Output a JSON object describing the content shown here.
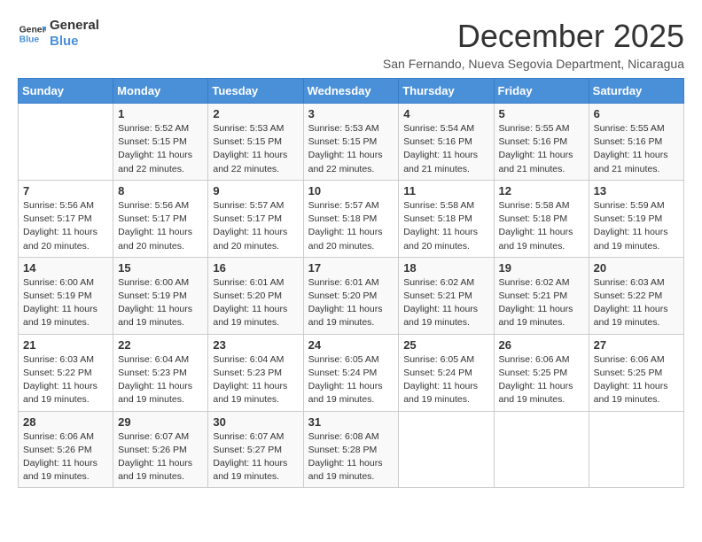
{
  "header": {
    "logo_line1": "General",
    "logo_line2": "Blue",
    "month_year": "December 2025",
    "subtitle": "San Fernando, Nueva Segovia Department, Nicaragua"
  },
  "days_of_week": [
    "Sunday",
    "Monday",
    "Tuesday",
    "Wednesday",
    "Thursday",
    "Friday",
    "Saturday"
  ],
  "weeks": [
    [
      {
        "day": "",
        "info": ""
      },
      {
        "day": "1",
        "info": "Sunrise: 5:52 AM\nSunset: 5:15 PM\nDaylight: 11 hours\nand 22 minutes."
      },
      {
        "day": "2",
        "info": "Sunrise: 5:53 AM\nSunset: 5:15 PM\nDaylight: 11 hours\nand 22 minutes."
      },
      {
        "day": "3",
        "info": "Sunrise: 5:53 AM\nSunset: 5:15 PM\nDaylight: 11 hours\nand 22 minutes."
      },
      {
        "day": "4",
        "info": "Sunrise: 5:54 AM\nSunset: 5:16 PM\nDaylight: 11 hours\nand 21 minutes."
      },
      {
        "day": "5",
        "info": "Sunrise: 5:55 AM\nSunset: 5:16 PM\nDaylight: 11 hours\nand 21 minutes."
      },
      {
        "day": "6",
        "info": "Sunrise: 5:55 AM\nSunset: 5:16 PM\nDaylight: 11 hours\nand 21 minutes."
      }
    ],
    [
      {
        "day": "7",
        "info": "Sunrise: 5:56 AM\nSunset: 5:17 PM\nDaylight: 11 hours\nand 20 minutes."
      },
      {
        "day": "8",
        "info": "Sunrise: 5:56 AM\nSunset: 5:17 PM\nDaylight: 11 hours\nand 20 minutes."
      },
      {
        "day": "9",
        "info": "Sunrise: 5:57 AM\nSunset: 5:17 PM\nDaylight: 11 hours\nand 20 minutes."
      },
      {
        "day": "10",
        "info": "Sunrise: 5:57 AM\nSunset: 5:18 PM\nDaylight: 11 hours\nand 20 minutes."
      },
      {
        "day": "11",
        "info": "Sunrise: 5:58 AM\nSunset: 5:18 PM\nDaylight: 11 hours\nand 20 minutes."
      },
      {
        "day": "12",
        "info": "Sunrise: 5:58 AM\nSunset: 5:18 PM\nDaylight: 11 hours\nand 19 minutes."
      },
      {
        "day": "13",
        "info": "Sunrise: 5:59 AM\nSunset: 5:19 PM\nDaylight: 11 hours\nand 19 minutes."
      }
    ],
    [
      {
        "day": "14",
        "info": "Sunrise: 6:00 AM\nSunset: 5:19 PM\nDaylight: 11 hours\nand 19 minutes."
      },
      {
        "day": "15",
        "info": "Sunrise: 6:00 AM\nSunset: 5:19 PM\nDaylight: 11 hours\nand 19 minutes."
      },
      {
        "day": "16",
        "info": "Sunrise: 6:01 AM\nSunset: 5:20 PM\nDaylight: 11 hours\nand 19 minutes."
      },
      {
        "day": "17",
        "info": "Sunrise: 6:01 AM\nSunset: 5:20 PM\nDaylight: 11 hours\nand 19 minutes."
      },
      {
        "day": "18",
        "info": "Sunrise: 6:02 AM\nSunset: 5:21 PM\nDaylight: 11 hours\nand 19 minutes."
      },
      {
        "day": "19",
        "info": "Sunrise: 6:02 AM\nSunset: 5:21 PM\nDaylight: 11 hours\nand 19 minutes."
      },
      {
        "day": "20",
        "info": "Sunrise: 6:03 AM\nSunset: 5:22 PM\nDaylight: 11 hours\nand 19 minutes."
      }
    ],
    [
      {
        "day": "21",
        "info": "Sunrise: 6:03 AM\nSunset: 5:22 PM\nDaylight: 11 hours\nand 19 minutes."
      },
      {
        "day": "22",
        "info": "Sunrise: 6:04 AM\nSunset: 5:23 PM\nDaylight: 11 hours\nand 19 minutes."
      },
      {
        "day": "23",
        "info": "Sunrise: 6:04 AM\nSunset: 5:23 PM\nDaylight: 11 hours\nand 19 minutes."
      },
      {
        "day": "24",
        "info": "Sunrise: 6:05 AM\nSunset: 5:24 PM\nDaylight: 11 hours\nand 19 minutes."
      },
      {
        "day": "25",
        "info": "Sunrise: 6:05 AM\nSunset: 5:24 PM\nDaylight: 11 hours\nand 19 minutes."
      },
      {
        "day": "26",
        "info": "Sunrise: 6:06 AM\nSunset: 5:25 PM\nDaylight: 11 hours\nand 19 minutes."
      },
      {
        "day": "27",
        "info": "Sunrise: 6:06 AM\nSunset: 5:25 PM\nDaylight: 11 hours\nand 19 minutes."
      }
    ],
    [
      {
        "day": "28",
        "info": "Sunrise: 6:06 AM\nSunset: 5:26 PM\nDaylight: 11 hours\nand 19 minutes."
      },
      {
        "day": "29",
        "info": "Sunrise: 6:07 AM\nSunset: 5:26 PM\nDaylight: 11 hours\nand 19 minutes."
      },
      {
        "day": "30",
        "info": "Sunrise: 6:07 AM\nSunset: 5:27 PM\nDaylight: 11 hours\nand 19 minutes."
      },
      {
        "day": "31",
        "info": "Sunrise: 6:08 AM\nSunset: 5:28 PM\nDaylight: 11 hours\nand 19 minutes."
      },
      {
        "day": "",
        "info": ""
      },
      {
        "day": "",
        "info": ""
      },
      {
        "day": "",
        "info": ""
      }
    ]
  ]
}
